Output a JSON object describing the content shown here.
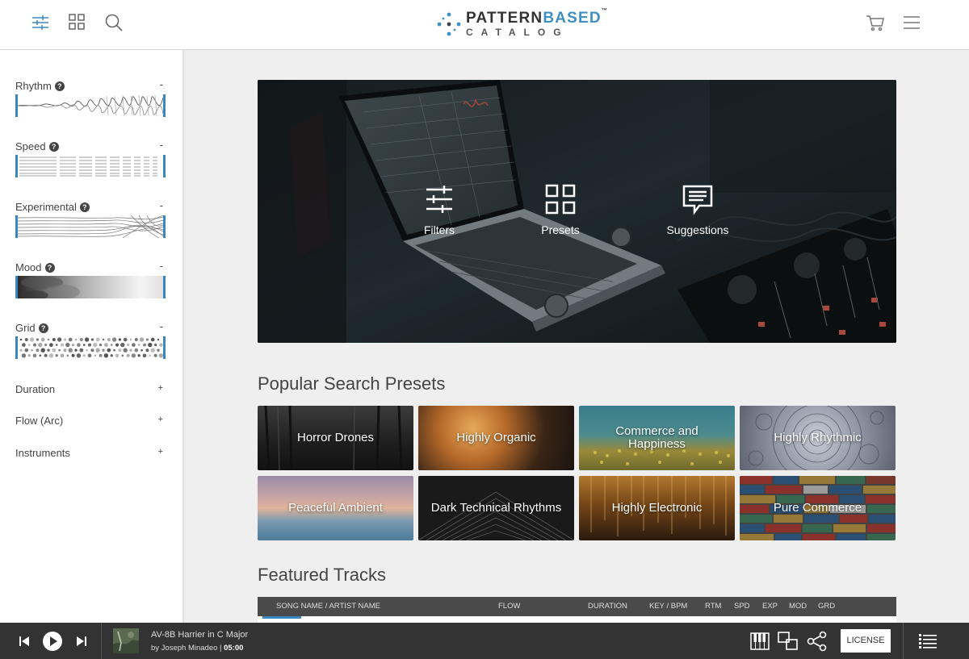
{
  "header": {
    "logo": {
      "brand_main": "PATTERN",
      "brand_accent": "BASED",
      "trademark": "™",
      "sub": "CATALOG"
    },
    "icons": [
      "filters-icon",
      "grid-icon",
      "search-icon",
      "cart-icon",
      "menu-icon"
    ]
  },
  "sidebar": {
    "filters": [
      {
        "label": "Rhythm",
        "help": "?",
        "toggle": "-"
      },
      {
        "label": "Speed",
        "help": "?",
        "toggle": "-"
      },
      {
        "label": "Experimental",
        "help": "?",
        "toggle": "-"
      },
      {
        "label": "Mood",
        "help": "?",
        "toggle": "-"
      },
      {
        "label": "Grid",
        "help": "?",
        "toggle": "-"
      }
    ],
    "collapsed": [
      {
        "label": "Duration",
        "toggle": "+"
      },
      {
        "label": "Flow (Arc)",
        "toggle": "+"
      },
      {
        "label": "Instruments",
        "toggle": "+"
      }
    ],
    "accent_color": "#3b87c0"
  },
  "hero": {
    "buttons": [
      {
        "label": "Filters",
        "icon": "sliders-icon"
      },
      {
        "label": "Presets",
        "icon": "grid-icon"
      },
      {
        "label": "Suggestions",
        "icon": "chat-icon"
      }
    ]
  },
  "presets": {
    "title": "Popular Search Presets",
    "items": [
      {
        "label": "Horror Drones"
      },
      {
        "label": "Highly Organic"
      },
      {
        "label": "Commerce and Happiness"
      },
      {
        "label": "Highly Rhythmic"
      },
      {
        "label": "Peaceful Ambient"
      },
      {
        "label": "Dark Technical Rhythms"
      },
      {
        "label": "Highly Electronic"
      },
      {
        "label": "Pure Commerce"
      }
    ]
  },
  "featured": {
    "title": "Featured Tracks",
    "columns": [
      "SONG NAME / ARTIST NAME",
      "FLOW",
      "DURATION",
      "KEY / BPM",
      "RTM",
      "SPD",
      "EXP",
      "MOD",
      "GRD"
    ]
  },
  "player": {
    "track_title": "AV-8B Harrier in C Major",
    "artist_prefix": "by Joseph Minadeo",
    "separator": "|",
    "duration": "05:00",
    "license_label": "LICENSE"
  }
}
